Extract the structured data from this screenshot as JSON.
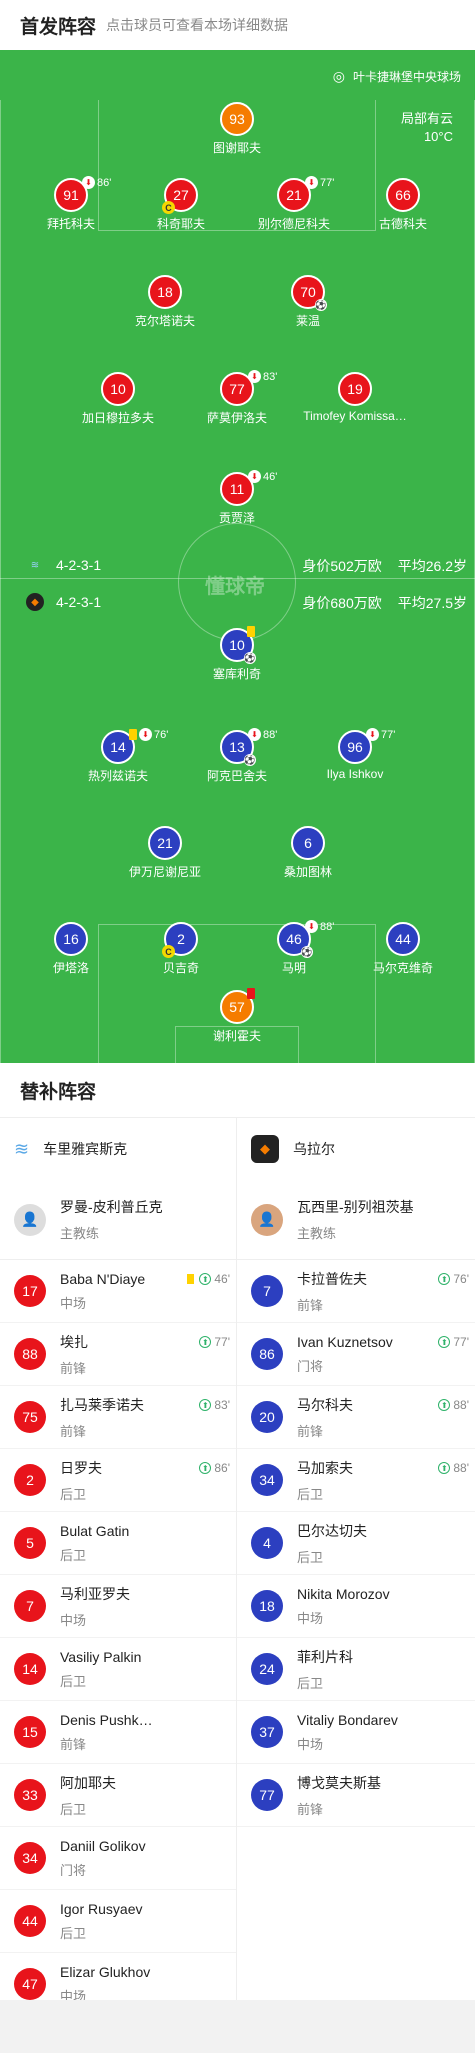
{
  "header": {
    "title": "首发阵容",
    "subtitle": "点击球员可查看本场详细数据"
  },
  "venue": {
    "stadium": "叶卡捷琳堡中央球场",
    "weather": "局部有云",
    "temp": "10°C"
  },
  "watermark": "懂球帝",
  "home": {
    "formation": "4-2-3-1",
    "value": "身价502万欧",
    "age": "平均26.2岁",
    "name": "车里雅宾斯克",
    "color": "#e8141b"
  },
  "away": {
    "formation": "4-2-3-1",
    "value": "身价680万欧",
    "age": "平均27.5岁",
    "name": "乌拉尔",
    "color": "#2c3fc0"
  },
  "home_players": [
    {
      "num": "93",
      "name": "图谢耶夫",
      "min": "",
      "gk": true
    },
    {
      "num": "91",
      "name": "拜托科夫",
      "min": "86'"
    },
    {
      "num": "27",
      "name": "科奇耶夫",
      "min": "",
      "cap": "C"
    },
    {
      "num": "21",
      "name": "别尔德尼科夫",
      "min": "77'"
    },
    {
      "num": "66",
      "name": "古德科夫",
      "min": ""
    },
    {
      "num": "18",
      "name": "克尔塔诺夫",
      "min": ""
    },
    {
      "num": "70",
      "name": "莱温",
      "min": ""
    },
    {
      "num": "10",
      "name": "加日穆拉多夫",
      "min": ""
    },
    {
      "num": "77",
      "name": "萨莫伊洛夫",
      "min": "83'"
    },
    {
      "num": "19",
      "name": "Timofey Komissa…",
      "min": ""
    },
    {
      "num": "11",
      "name": "贡贾泽",
      "min": "46'"
    }
  ],
  "away_players": [
    {
      "num": "10",
      "name": "塞库利奇"
    },
    {
      "num": "14",
      "name": "热列兹诺夫",
      "min": "76'"
    },
    {
      "num": "13",
      "name": "阿克巴舍夫",
      "min": "88'"
    },
    {
      "num": "96",
      "name": "Ilya Ishkov",
      "min": "77'"
    },
    {
      "num": "21",
      "name": "伊万尼谢尼亚"
    },
    {
      "num": "6",
      "name": "桑加图林"
    },
    {
      "num": "16",
      "name": "伊塔洛"
    },
    {
      "num": "2",
      "name": "贝吉奇",
      "cap": "C"
    },
    {
      "num": "46",
      "name": "马明",
      "min": "88'"
    },
    {
      "num": "44",
      "name": "马尔克维奇"
    },
    {
      "num": "57",
      "name": "谢利霍夫"
    }
  ],
  "subs": {
    "title": "替补阵容",
    "home_coach": {
      "name": "罗曼-皮利普丘克",
      "role": "主教练"
    },
    "away_coach": {
      "name": "瓦西里-别列祖茨基",
      "role": "主教练"
    },
    "home": [
      {
        "num": "17",
        "name": "Baba N'Diaye",
        "pos": "中场",
        "min": "46'",
        "y": true
      },
      {
        "num": "88",
        "name": "埃扎",
        "pos": "前锋",
        "min": "77'"
      },
      {
        "num": "75",
        "name": "扎马莱季诺夫",
        "pos": "前锋",
        "min": "83'"
      },
      {
        "num": "2",
        "name": "日罗夫",
        "pos": "后卫",
        "min": "86'"
      },
      {
        "num": "5",
        "name": "Bulat Gatin",
        "pos": "后卫",
        "min": ""
      },
      {
        "num": "7",
        "name": "马利亚罗夫",
        "pos": "中场",
        "min": ""
      },
      {
        "num": "14",
        "name": "Vasiliy Palkin",
        "pos": "后卫",
        "min": ""
      },
      {
        "num": "15",
        "name": "Denis Pushk…",
        "pos": "前锋",
        "min": ""
      },
      {
        "num": "33",
        "name": "阿加耶夫",
        "pos": "后卫",
        "min": ""
      },
      {
        "num": "34",
        "name": "Daniil Golikov",
        "pos": "门将",
        "min": ""
      },
      {
        "num": "44",
        "name": "Igor Rusyaev",
        "pos": "后卫",
        "min": ""
      },
      {
        "num": "47",
        "name": "Elizar Glukhov",
        "pos": "中场",
        "min": ""
      }
    ],
    "away": [
      {
        "num": "7",
        "name": "卡拉普佐夫",
        "pos": "前锋",
        "min": "76'"
      },
      {
        "num": "86",
        "name": "Ivan Kuznetsov",
        "pos": "门将",
        "min": "77'"
      },
      {
        "num": "20",
        "name": "马尔科夫",
        "pos": "前锋",
        "min": "88'"
      },
      {
        "num": "34",
        "name": "马加索夫",
        "pos": "后卫",
        "min": "88'"
      },
      {
        "num": "4",
        "name": "巴尔达切夫",
        "pos": "后卫",
        "min": ""
      },
      {
        "num": "18",
        "name": "Nikita Morozov",
        "pos": "中场",
        "min": ""
      },
      {
        "num": "24",
        "name": "菲利片科",
        "pos": "后卫",
        "min": ""
      },
      {
        "num": "37",
        "name": "Vitaliy Bondarev",
        "pos": "中场",
        "min": ""
      },
      {
        "num": "77",
        "name": "博戈莫夫斯基",
        "pos": "前锋",
        "min": ""
      }
    ]
  }
}
